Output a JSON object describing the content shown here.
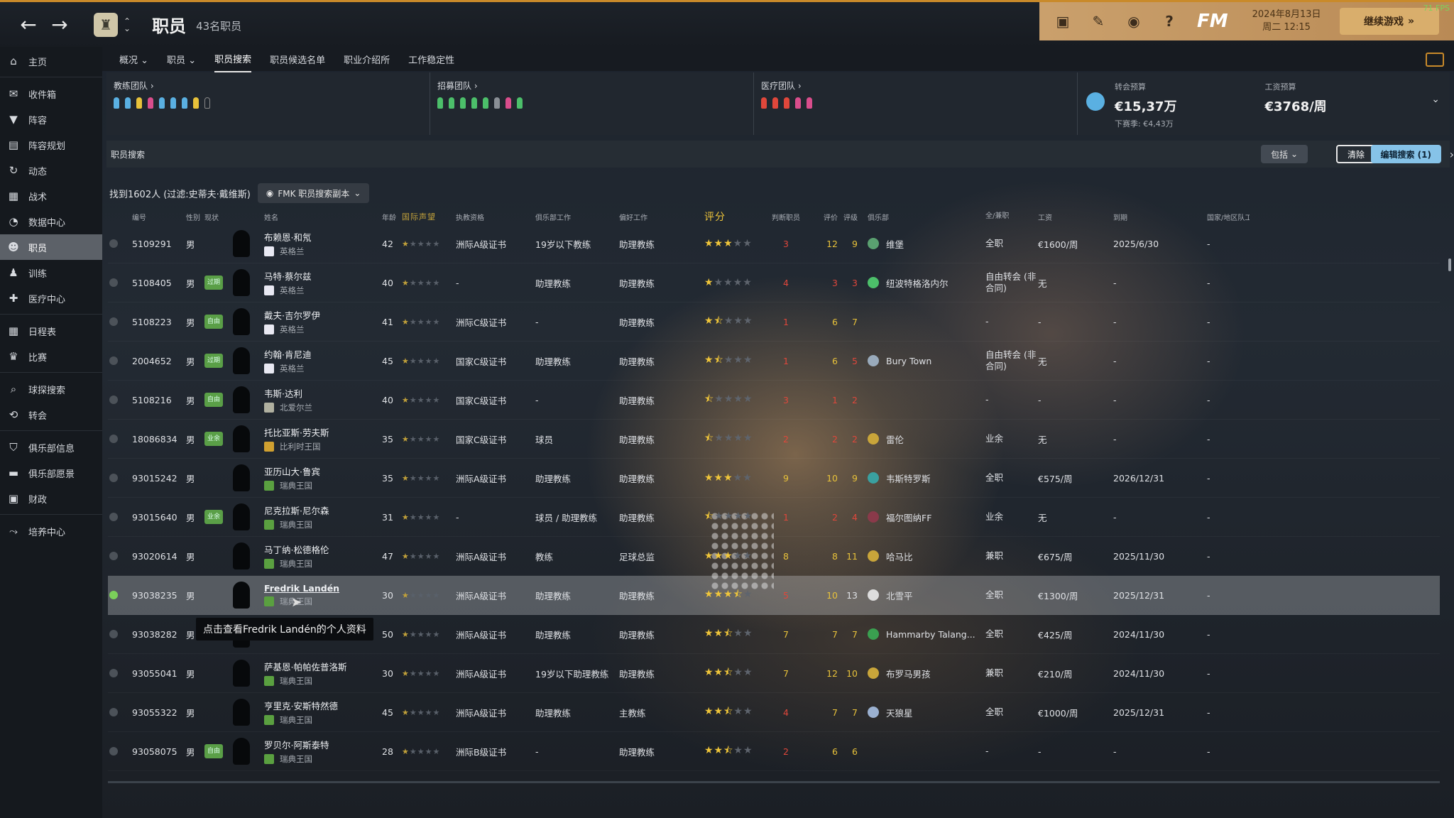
{
  "topbar": {
    "title": "职员",
    "subtitle": "43名职员",
    "fm_logo": "FM",
    "date_line1": "2024年8月13日",
    "date_line2": "周二 12:15",
    "continue_label": "继续游戏",
    "fps": "71 FPS"
  },
  "sidebar": {
    "items": [
      {
        "label": "主页",
        "icon": "home-icon"
      },
      {
        "label": "收件箱",
        "icon": "inbox-icon"
      },
      {
        "label": "阵容",
        "icon": "shirt-icon"
      },
      {
        "label": "阵容规划",
        "icon": "clipboard-icon"
      },
      {
        "label": "动态",
        "icon": "activity-icon"
      },
      {
        "label": "战术",
        "icon": "tactics-icon"
      },
      {
        "label": "数据中心",
        "icon": "data-icon"
      },
      {
        "label": "职员",
        "icon": "staff-icon"
      },
      {
        "label": "训练",
        "icon": "training-icon"
      },
      {
        "label": "医疗中心",
        "icon": "medical-icon"
      },
      {
        "label": "日程表",
        "icon": "calendar-icon"
      },
      {
        "label": "比赛",
        "icon": "trophy-icon"
      },
      {
        "label": "球探搜索",
        "icon": "scout-icon"
      },
      {
        "label": "转会",
        "icon": "transfer-icon"
      },
      {
        "label": "俱乐部信息",
        "icon": "shield-icon"
      },
      {
        "label": "俱乐部愿景",
        "icon": "vision-icon"
      },
      {
        "label": "财政",
        "icon": "finance-icon"
      },
      {
        "label": "培养中心",
        "icon": "development-icon"
      }
    ]
  },
  "subnav": {
    "tabs": [
      "概况",
      "职员",
      "职员搜索",
      "职员候选名单",
      "职业介绍所",
      "工作稳定性"
    ]
  },
  "staff_panel": {
    "coaching": "教练团队 ›",
    "recruitment": "招募团队 ›",
    "medical": "医疗团队 ›",
    "transfer_budget_label": "转会预算",
    "transfer_budget_value": "€15,37万",
    "transfer_budget_next": "下赛季: €4,43万",
    "wage_budget_label": "工资预算",
    "wage_budget_value": "€3768/周"
  },
  "search": {
    "title": "职员搜索",
    "include_label": "包括",
    "clear_label": "清除",
    "edit_label": "编辑搜索 (1)",
    "results": "找到1602人 (过滤:史蒂夫·戴维斯)",
    "view_label": "FMK 职员搜索副本"
  },
  "table": {
    "headers": [
      "编号",
      "性别",
      "现状",
      "姓名",
      "年龄",
      "国际声望",
      "执教资格",
      "俱乐部工作",
      "偏好工作",
      "评分",
      "判断职员",
      "评价",
      "评级",
      "俱乐部",
      "全/兼职",
      "工资",
      "到期",
      "国家/地区队工作"
    ],
    "rows": [
      {
        "id": "5109291",
        "sex": "男",
        "status": "",
        "name": "布赖恩·和氖",
        "nat": "英格兰",
        "age": "42",
        "lic": "洲际A级证书",
        "cjob": "19岁以下教练",
        "pjob": "助理教练",
        "stars": 3,
        "judge": "3",
        "eval": "12",
        "rate": "9",
        "club": "维堡",
        "ft": "全职",
        "wage": "€1600/周",
        "exp": "2025/6/30",
        "natjob": "-"
      },
      {
        "id": "5108405",
        "sex": "男",
        "status": "过期",
        "name": "马特·蔡尔兹",
        "nat": "英格兰",
        "age": "40",
        "lic": "-",
        "cjob": "助理教练",
        "pjob": "助理教练",
        "stars": 1,
        "judge": "4",
        "eval": "3",
        "rate": "3",
        "club": "纽波特格洛内尔",
        "ft": "自由转会 (非合同)",
        "wage": "无",
        "exp": "-",
        "natjob": "-"
      },
      {
        "id": "5108223",
        "sex": "男",
        "status": "自由",
        "name": "戴夫·吉尔罗伊",
        "nat": "英格兰",
        "age": "41",
        "lic": "洲际C级证书",
        "cjob": "-",
        "pjob": "助理教练",
        "stars": 1.5,
        "judge": "1",
        "eval": "6",
        "rate": "7",
        "club": "",
        "ft": "-",
        "wage": "-",
        "exp": "-",
        "natjob": "-"
      },
      {
        "id": "2004652",
        "sex": "男",
        "status": "过期",
        "name": "约翰·肯尼迪",
        "nat": "英格兰",
        "age": "45",
        "lic": "国家C级证书",
        "cjob": "助理教练",
        "pjob": "助理教练",
        "stars": 1.5,
        "judge": "1",
        "eval": "6",
        "rate": "5",
        "club": "Bury Town",
        "ft": "自由转会 (非合同)",
        "wage": "无",
        "exp": "-",
        "natjob": "-"
      },
      {
        "id": "5108216",
        "sex": "男",
        "status": "自由",
        "name": "韦斯·达利",
        "nat": "北爱尔兰",
        "age": "40",
        "lic": "国家C级证书",
        "cjob": "-",
        "pjob": "助理教练",
        "stars": 0.5,
        "judge": "3",
        "eval": "1",
        "rate": "2",
        "club": "",
        "ft": "-",
        "wage": "-",
        "exp": "-",
        "natjob": "-"
      },
      {
        "id": "18086834",
        "sex": "男",
        "status": "业余",
        "name": "托比亚斯·劳夫斯",
        "nat": "比利时王国",
        "age": "35",
        "lic": "国家C级证书",
        "cjob": "球员",
        "pjob": "助理教练",
        "stars": 0.5,
        "judge": "2",
        "eval": "2",
        "rate": "2",
        "club": "雷伦",
        "ft": "业余",
        "wage": "无",
        "exp": "-",
        "natjob": "-"
      },
      {
        "id": "93015242",
        "sex": "男",
        "status": "",
        "name": "亚历山大·鲁宾",
        "nat": "瑞典王国",
        "age": "35",
        "lic": "洲际A级证书",
        "cjob": "助理教练",
        "pjob": "助理教练",
        "stars": 3,
        "judge": "9",
        "eval": "10",
        "rate": "9",
        "club": "韦斯特罗斯",
        "ft": "全职",
        "wage": "€575/周",
        "exp": "2026/12/31",
        "natjob": "-"
      },
      {
        "id": "93015640",
        "sex": "男",
        "status": "业余",
        "name": "尼克拉斯·尼尔森",
        "nat": "瑞典王国",
        "age": "31",
        "lic": "-",
        "cjob": "球员 / 助理教练",
        "pjob": "助理教练",
        "stars": 0.5,
        "judge": "1",
        "eval": "2",
        "rate": "4",
        "club": "福尔图纳FF",
        "ft": "业余",
        "wage": "无",
        "exp": "-",
        "natjob": "-"
      },
      {
        "id": "93020614",
        "sex": "男",
        "status": "",
        "name": "马丁纳·松德格伦",
        "nat": "瑞典王国",
        "age": "47",
        "lic": "洲际A级证书",
        "cjob": "教练",
        "pjob": "足球总监",
        "stars": 3,
        "judge": "8",
        "eval": "8",
        "rate": "11",
        "club": "哈马比",
        "ft": "兼职",
        "wage": "€675/周",
        "exp": "2025/11/30",
        "natjob": "-"
      },
      {
        "id": "93038235",
        "sex": "男",
        "status": "",
        "name": "Fredrik Landén",
        "nat": "瑞典王国",
        "age": "30",
        "lic": "洲际A级证书",
        "cjob": "助理教练",
        "pjob": "助理教练",
        "stars": 3.5,
        "judge": "5",
        "eval": "10",
        "rate": "13",
        "club": "北雪平",
        "ft": "全职",
        "wage": "€1300/周",
        "exp": "2025/12/31",
        "natjob": "-",
        "selected": true
      },
      {
        "id": "93038282",
        "sex": "男",
        "status": "",
        "name": "",
        "nat": "瑞典王国",
        "age": "50",
        "lic": "洲际A级证书",
        "cjob": "助理教练",
        "pjob": "助理教练",
        "stars": 2.5,
        "judge": "7",
        "eval": "7",
        "rate": "7",
        "club": "Hammarby Talang...",
        "ft": "全职",
        "wage": "€425/周",
        "exp": "2024/11/30",
        "natjob": "-"
      },
      {
        "id": "93055041",
        "sex": "男",
        "status": "",
        "name": "萨基恩·帕帕佐普洛斯",
        "nat": "瑞典王国",
        "age": "30",
        "lic": "洲际A级证书",
        "cjob": "19岁以下助理教练",
        "pjob": "助理教练",
        "stars": 2.5,
        "judge": "7",
        "eval": "12",
        "rate": "10",
        "club": "布罗马男孩",
        "ft": "兼职",
        "wage": "€210/周",
        "exp": "2024/11/30",
        "natjob": "-"
      },
      {
        "id": "93055322",
        "sex": "男",
        "status": "",
        "name": "亨里克·安斯特然德",
        "nat": "瑞典王国",
        "age": "45",
        "lic": "洲际A级证书",
        "cjob": "助理教练",
        "pjob": "主教练",
        "stars": 2.5,
        "judge": "4",
        "eval": "7",
        "rate": "7",
        "club": "天狼星",
        "ft": "全职",
        "wage": "€1000/周",
        "exp": "2025/12/31",
        "natjob": "-"
      },
      {
        "id": "93058075",
        "sex": "男",
        "status": "自由",
        "name": "罗贝尔·阿斯泰特",
        "nat": "瑞典王国",
        "age": "28",
        "lic": "洲际B级证书",
        "cjob": "-",
        "pjob": "助理教练",
        "stars": 2.5,
        "judge": "2",
        "eval": "6",
        "rate": "6",
        "club": "",
        "ft": "-",
        "wage": "-",
        "exp": "-",
        "natjob": "-"
      }
    ]
  },
  "tooltip": "点击查看Fredrik Landén的个人资料",
  "colors": {
    "accent": "#c98a2a",
    "budget_bar": "#caa06c",
    "edit_button": "#86c3e8",
    "star": "#f0c63a",
    "low_value": "#e0473b",
    "mid_value": "#e8c23a"
  }
}
